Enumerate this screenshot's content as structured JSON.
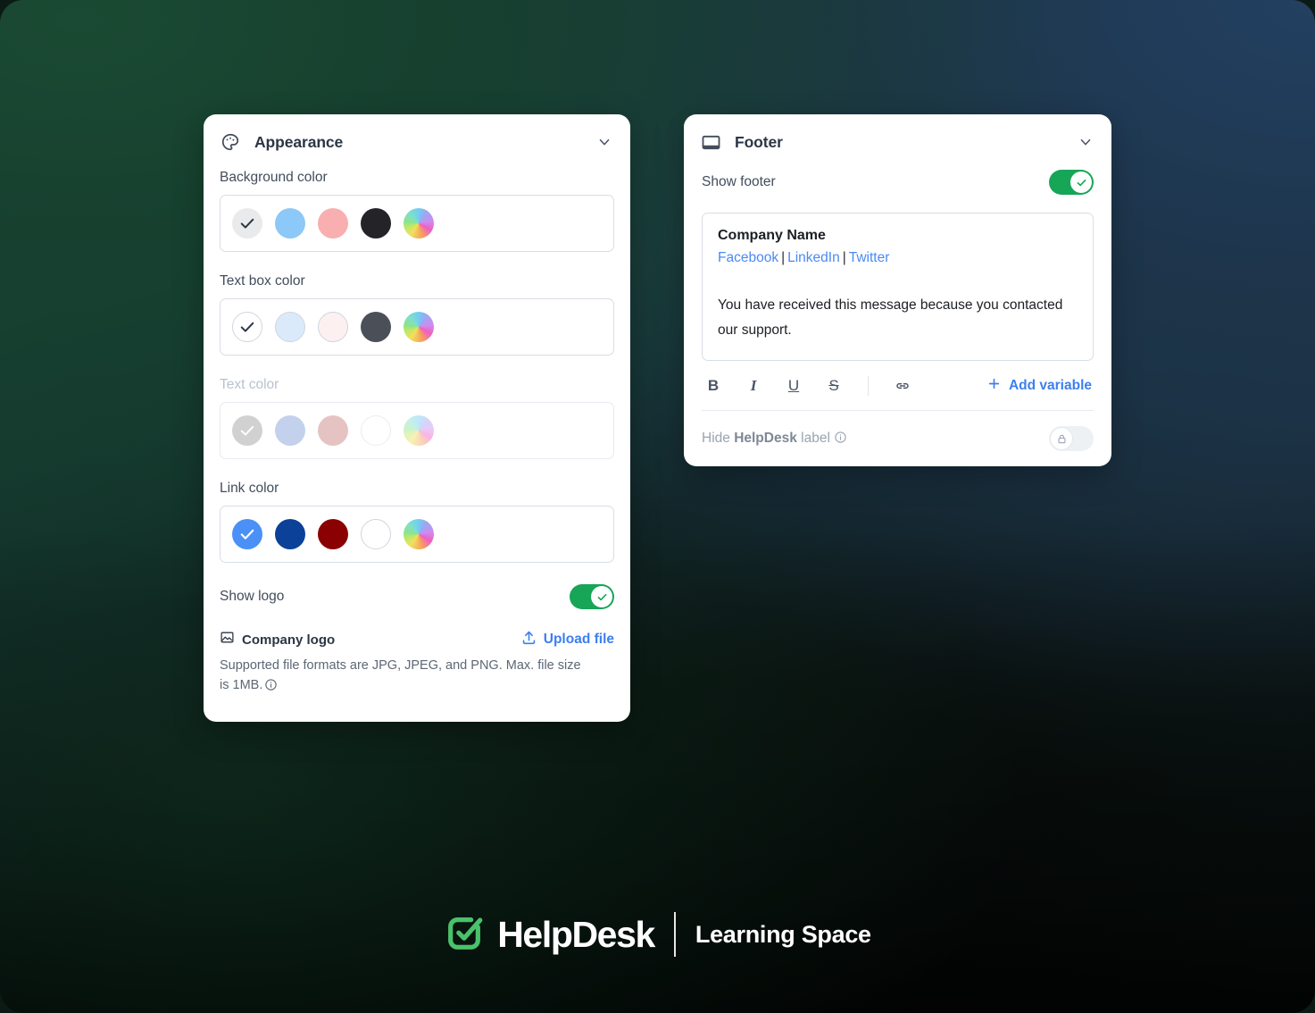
{
  "appearance": {
    "icon": "palette-icon",
    "title": "Appearance",
    "collapse_icon": "chevron-down-icon",
    "groups": [
      {
        "label": "Background color",
        "disabled": false,
        "swatches": [
          {
            "name": "swatch-light-gray",
            "color": "#e9eaec",
            "selected": true,
            "check_color": "#2c3645",
            "bordered": false,
            "wheel": false
          },
          {
            "name": "swatch-light-blue",
            "color": "#8cc8f8",
            "selected": false,
            "bordered": false,
            "wheel": false
          },
          {
            "name": "swatch-pink",
            "color": "#f9afaf",
            "selected": false,
            "bordered": false,
            "wheel": false
          },
          {
            "name": "swatch-black",
            "color": "#232328",
            "selected": false,
            "bordered": false,
            "wheel": false
          },
          {
            "name": "swatch-custom-color-wheel",
            "color": "",
            "selected": false,
            "bordered": false,
            "wheel": true
          }
        ]
      },
      {
        "label": "Text box color",
        "disabled": false,
        "swatches": [
          {
            "name": "swatch-white",
            "color": "#ffffff",
            "selected": true,
            "check_color": "#2c3645",
            "bordered": true,
            "wheel": false
          },
          {
            "name": "swatch-pale-blue",
            "color": "#dbeafb",
            "selected": false,
            "bordered": true,
            "wheel": false
          },
          {
            "name": "swatch-pale-pink",
            "color": "#fdf0f0",
            "selected": false,
            "bordered": true,
            "wheel": false
          },
          {
            "name": "swatch-dark-slate",
            "color": "#4a4f58",
            "selected": false,
            "bordered": false,
            "wheel": false
          },
          {
            "name": "swatch-custom-color-wheel",
            "color": "",
            "selected": false,
            "bordered": false,
            "wheel": true
          }
        ]
      },
      {
        "label": "Text color",
        "disabled": true,
        "swatches": [
          {
            "name": "swatch-gray",
            "color": "#9a9a9a",
            "selected": true,
            "check_color": "#ffffff",
            "bordered": false,
            "wheel": false
          },
          {
            "name": "swatch-steel-blue",
            "color": "#7b9ad8",
            "selected": false,
            "bordered": false,
            "wheel": false
          },
          {
            "name": "swatch-dusty-rose",
            "color": "#c87b7b",
            "selected": false,
            "bordered": false,
            "wheel": false
          },
          {
            "name": "swatch-white",
            "color": "#ffffff",
            "selected": false,
            "bordered": true,
            "wheel": false
          },
          {
            "name": "swatch-custom-color-wheel",
            "color": "",
            "selected": false,
            "bordered": false,
            "wheel": true
          }
        ]
      },
      {
        "label": "Link color",
        "disabled": false,
        "swatches": [
          {
            "name": "swatch-blue",
            "color": "#4a90f7",
            "selected": true,
            "check_color": "#ffffff",
            "bordered": false,
            "wheel": false
          },
          {
            "name": "swatch-navy",
            "color": "#0b4199",
            "selected": false,
            "bordered": false,
            "wheel": false
          },
          {
            "name": "swatch-dark-red",
            "color": "#8b0000",
            "selected": false,
            "bordered": false,
            "wheel": false
          },
          {
            "name": "swatch-white",
            "color": "#ffffff",
            "selected": false,
            "bordered": true,
            "wheel": false
          },
          {
            "name": "swatch-custom-color-wheel",
            "color": "",
            "selected": false,
            "bordered": false,
            "wheel": true
          }
        ]
      }
    ],
    "show_logo": {
      "label": "Show logo",
      "enabled": true
    },
    "logo_upload": {
      "icon": "image-icon",
      "label": "Company logo",
      "upload_icon": "upload-icon",
      "upload_label": "Upload file",
      "help_text": "Supported file formats are JPG, JPEG, and PNG. Max. file size is 1MB.",
      "info_icon": "info-icon"
    }
  },
  "footer_panel": {
    "icon": "footer-icon",
    "title": "Footer",
    "collapse_icon": "chevron-down-icon",
    "show_footer": {
      "label": "Show footer",
      "enabled": true
    },
    "editor": {
      "company_name": "Company Name",
      "links": [
        "Facebook",
        "LinkedIn",
        "Twitter"
      ],
      "link_separator": "|",
      "body": "You have received this message because you contacted our support."
    },
    "toolbar": {
      "bold": "B",
      "italic": "I",
      "underline": "U",
      "strikethrough": "S",
      "link_icon": "link-icon",
      "add_variable_icon": "plus-icon",
      "add_variable_label": "Add variable"
    },
    "hide_label_row": {
      "prefix": "Hide ",
      "brand": "HelpDesk",
      "suffix": " label",
      "info_icon": "info-icon",
      "lock_icon": "lock-icon",
      "enabled": false,
      "locked": true
    }
  },
  "brand": {
    "logo_icon": "helpdesk-check-logo",
    "name": "HelpDesk",
    "subtitle": "Learning Space"
  },
  "colors": {
    "accent_blue": "#3c7ff0",
    "toggle_green": "#17a557",
    "brand_green": "#4ac26b",
    "text_dark": "#2c3645",
    "text_muted": "#5d6775",
    "border": "#d8dee6"
  }
}
